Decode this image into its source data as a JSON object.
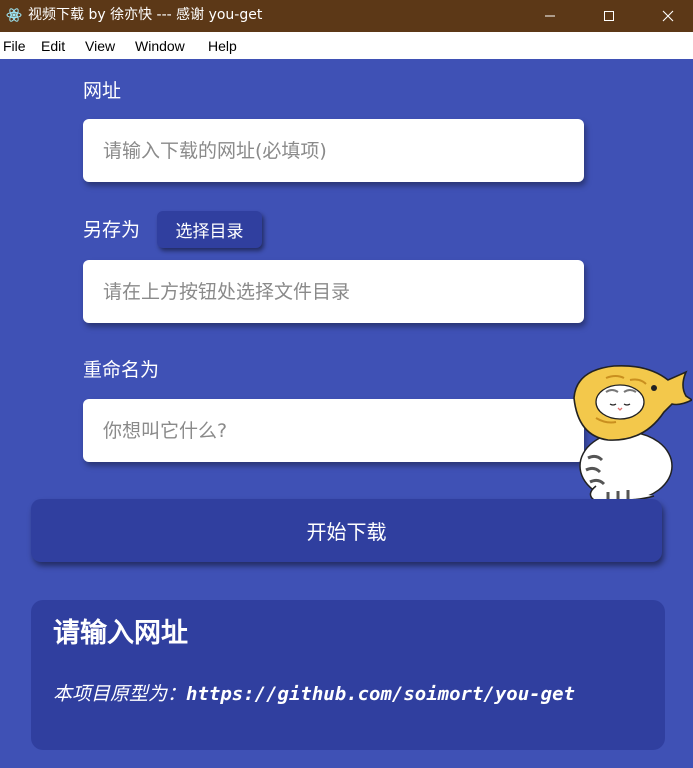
{
  "window": {
    "title": "视频下载 by 徐亦快 --- 感谢 you-get",
    "icon": "electron-icon",
    "controls": [
      "minimize-icon",
      "maximize-icon",
      "close-icon"
    ]
  },
  "menu": {
    "items": [
      "File",
      "Edit",
      "View",
      "Window",
      "Help"
    ]
  },
  "form": {
    "url": {
      "label": "网址",
      "placeholder": "请输入下载的网址(必填项)",
      "value": ""
    },
    "save_as": {
      "label": "另存为",
      "button_label": "选择目录",
      "placeholder": "请在上方按钮处选择文件目录",
      "value": ""
    },
    "rename": {
      "label": "重命名为",
      "placeholder": "你想叫它什么?",
      "value": ""
    },
    "start_button": "开始下载"
  },
  "info": {
    "title": "请输入网址",
    "prefix": "本项目原型为：",
    "link": "https://github.com/soimort/you-get"
  },
  "colors": {
    "background": "#3f51b5",
    "panel": "#303f9f",
    "titlebar": "#5c3817",
    "input_bg": "#ffffff"
  },
  "decoration": "cat-in-taiyaki-hat-mascot"
}
